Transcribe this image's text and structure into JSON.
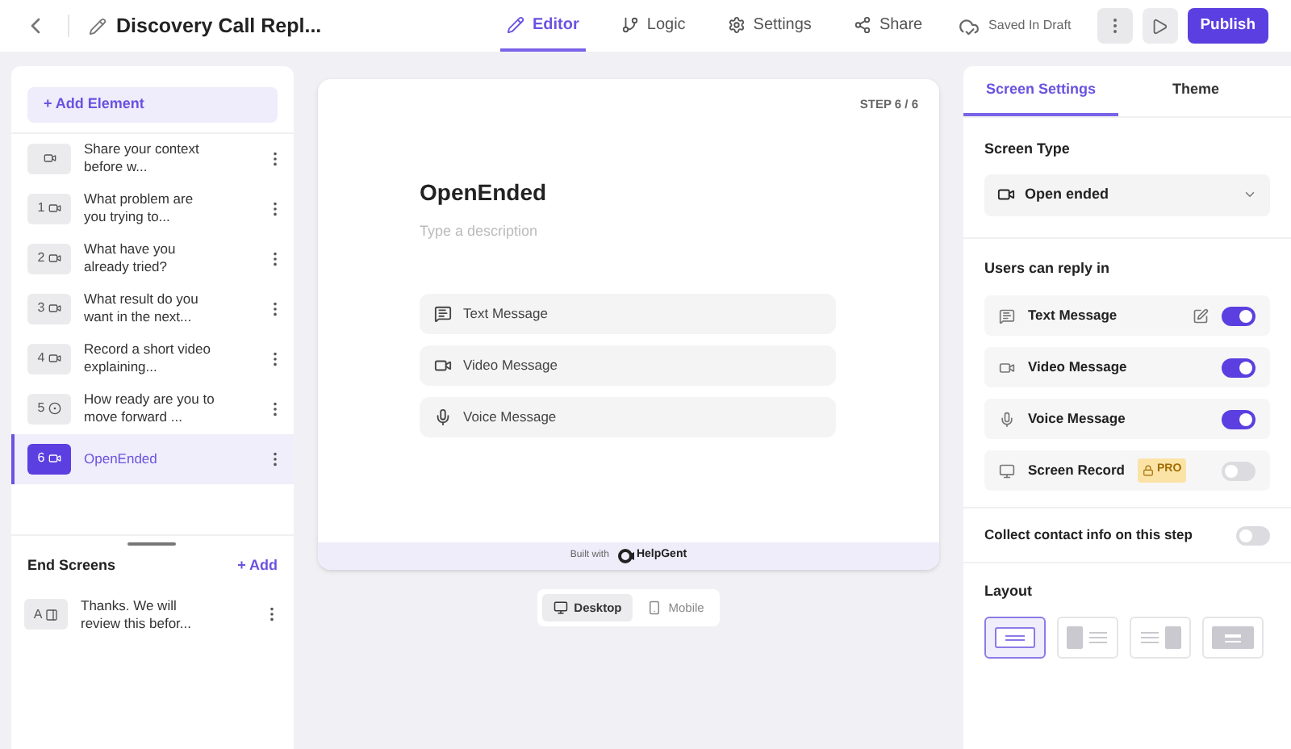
{
  "header": {
    "title": "Discovery Call Repl...",
    "tabs": [
      {
        "label": "Editor",
        "selected": true
      },
      {
        "label": "Logic",
        "selected": false
      },
      {
        "label": "Settings",
        "selected": false
      },
      {
        "label": "Share",
        "selected": false
      }
    ],
    "status": "Saved In Draft",
    "publish": "Publish"
  },
  "sidebar": {
    "add_element": "+ Add Element",
    "elements": [
      {
        "kind": "video",
        "text": "Share your context before w...",
        "selected": false
      },
      {
        "number": "1",
        "kind": "video",
        "text": "What problem are you trying to...",
        "selected": false
      },
      {
        "number": "2",
        "kind": "video",
        "text": "What have you already tried?",
        "selected": false
      },
      {
        "number": "3",
        "kind": "video",
        "text": "What result do you want in the next...",
        "selected": false
      },
      {
        "number": "4",
        "kind": "video",
        "text": "Record a short video explaining...",
        "selected": false
      },
      {
        "number": "5",
        "kind": "choice",
        "text": "How ready are you to move forward ...",
        "selected": false
      },
      {
        "number": "6",
        "kind": "video",
        "text": "OpenEnded",
        "selected": true
      }
    ],
    "end_screens": {
      "title": "End Screens",
      "add": "+ Add",
      "items": [
        {
          "number": "A",
          "text": "Thanks. We will review this befor..."
        }
      ]
    }
  },
  "preview": {
    "step": "STEP 6 / 6",
    "title": "OpenEnded",
    "description_placeholder": "Type a description",
    "options": [
      {
        "kind": "text",
        "label": "Text Message"
      },
      {
        "kind": "video",
        "label": "Video Message"
      },
      {
        "kind": "voice",
        "label": "Voice Message"
      }
    ],
    "built_with": "Built with",
    "brand": "HelpGent",
    "devices": [
      {
        "label": "Desktop",
        "selected": true
      },
      {
        "label": "Mobile",
        "selected": false
      }
    ]
  },
  "settings": {
    "tabs": [
      {
        "label": "Screen Settings",
        "selected": true
      },
      {
        "label": "Theme",
        "selected": false
      }
    ],
    "screen_type": {
      "label": "Screen Type",
      "value": "Open ended"
    },
    "reply_title": "Users can reply in",
    "reply_options": [
      {
        "kind": "text",
        "label": "Text Message",
        "editable": true,
        "on": true
      },
      {
        "kind": "video",
        "label": "Video Message",
        "editable": false,
        "on": true
      },
      {
        "kind": "voice",
        "label": "Voice Message",
        "editable": false,
        "on": true
      },
      {
        "kind": "screen",
        "label": "Screen Record",
        "badge": "PRO",
        "editable": false,
        "on": false
      }
    ],
    "contact": {
      "label": "Collect contact info on this step",
      "on": false
    },
    "layout": {
      "title": "Layout",
      "options": [
        {
          "kind": "centered",
          "selected": true
        },
        {
          "kind": "left",
          "selected": false
        },
        {
          "kind": "right",
          "selected": false
        },
        {
          "kind": "background",
          "selected": false
        }
      ]
    }
  }
}
